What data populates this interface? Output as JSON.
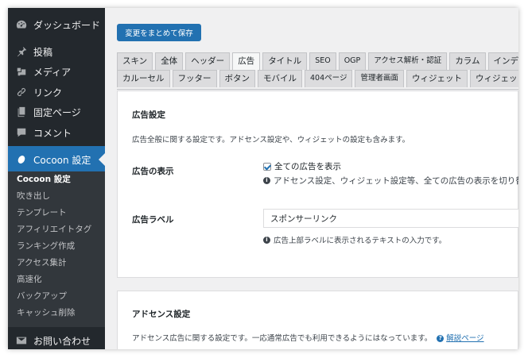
{
  "sidebar": {
    "top_items": [
      {
        "label": "ダッシュボード",
        "icon": "dashboard-icon"
      },
      {
        "label": "投稿",
        "icon": "pin-icon"
      },
      {
        "label": "メディア",
        "icon": "media-icon"
      },
      {
        "label": "リンク",
        "icon": "link-icon"
      },
      {
        "label": "固定ページ",
        "icon": "page-icon"
      },
      {
        "label": "コメント",
        "icon": "comment-icon"
      }
    ],
    "active_item": {
      "label": "Cocoon 設定",
      "icon": "cocoon-icon"
    },
    "submenu": [
      "Cocoon 設定",
      "吹き出し",
      "テンプレート",
      "アフィリエイトタグ",
      "ランキング作成",
      "アクセス集計",
      "高速化",
      "バックアップ",
      "キャッシュ削除"
    ],
    "bottom_item": {
      "label": "お問い合わせ",
      "icon": "mail-icon"
    }
  },
  "toolbar": {
    "save_label": "変更をまとめて保存"
  },
  "tabs": {
    "row1": [
      "スキン",
      "全体",
      "ヘッダー",
      "広告",
      "タイトル",
      "SEO",
      "OGP",
      "アクセス解析・認証",
      "カラム",
      "インデックス"
    ],
    "row2": [
      "カルーセル",
      "フッター",
      "ボタン",
      "モバイル",
      "404ページ",
      "管理者画面",
      "ウィジェット",
      "ウィジェットエリア"
    ],
    "active": "広告"
  },
  "ad_settings": {
    "title": "広告設定",
    "description": "広告全般に関する設定です。アドセンス設定や、ウィジェットの設定も含みます。",
    "display": {
      "label": "広告の表示",
      "checkbox_label": "全ての広告を表示",
      "checked": true,
      "info": "アドセンス設定、ウィジェット設定等、全ての広告の表示を切り替えます。"
    },
    "ad_label": {
      "label": "広告ラベル",
      "value": "スポンサーリンク",
      "info": "広告上部ラベルに表示されるテキストの入力です。"
    }
  },
  "adsense": {
    "title": "アドセンス設定",
    "description": "アドセンス広告に関する設定です。一応通常広告でも利用できるようにはなっています。",
    "help_link": "解説ページ"
  }
}
